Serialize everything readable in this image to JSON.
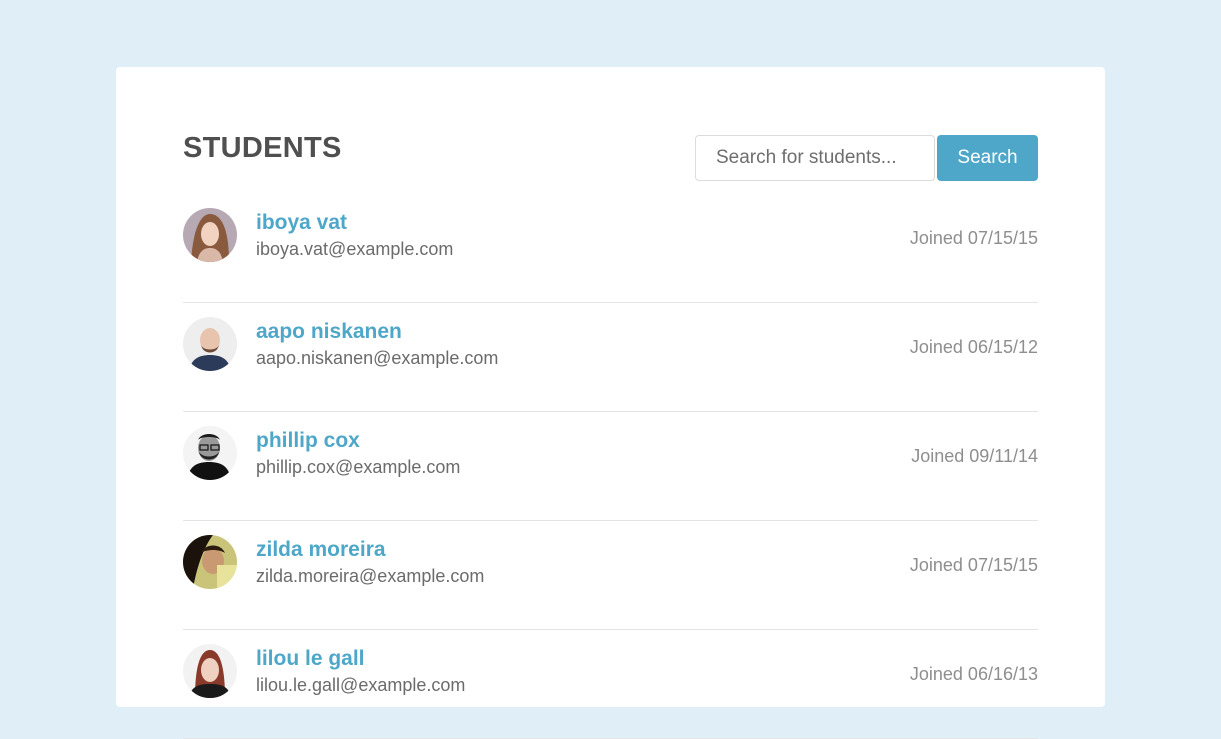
{
  "page": {
    "title": "STUDENTS"
  },
  "search": {
    "placeholder": "Search for students...",
    "value": "",
    "button_label": "Search"
  },
  "colors": {
    "background": "#e0eff7",
    "accent": "#4ea7c9",
    "title": "#4f4f4f"
  },
  "students": [
    {
      "name": "iboya vat",
      "email": "iboya.vat@example.com",
      "joined": "Joined 07/15/15",
      "avatar": "woman-portrait"
    },
    {
      "name": "aapo niskanen",
      "email": "aapo.niskanen@example.com",
      "joined": "Joined 06/15/12",
      "avatar": "bald-man-portrait"
    },
    {
      "name": "phillip cox",
      "email": "phillip.cox@example.com",
      "joined": "Joined 09/11/14",
      "avatar": "man-glasses-portrait"
    },
    {
      "name": "zilda moreira",
      "email": "zilda.moreira@example.com",
      "joined": "Joined 07/15/15",
      "avatar": "woman-dark-hair-portrait"
    },
    {
      "name": "lilou le gall",
      "email": "lilou.le.gall@example.com",
      "joined": "Joined 06/16/13",
      "avatar": "woman-red-hair-portrait"
    }
  ]
}
